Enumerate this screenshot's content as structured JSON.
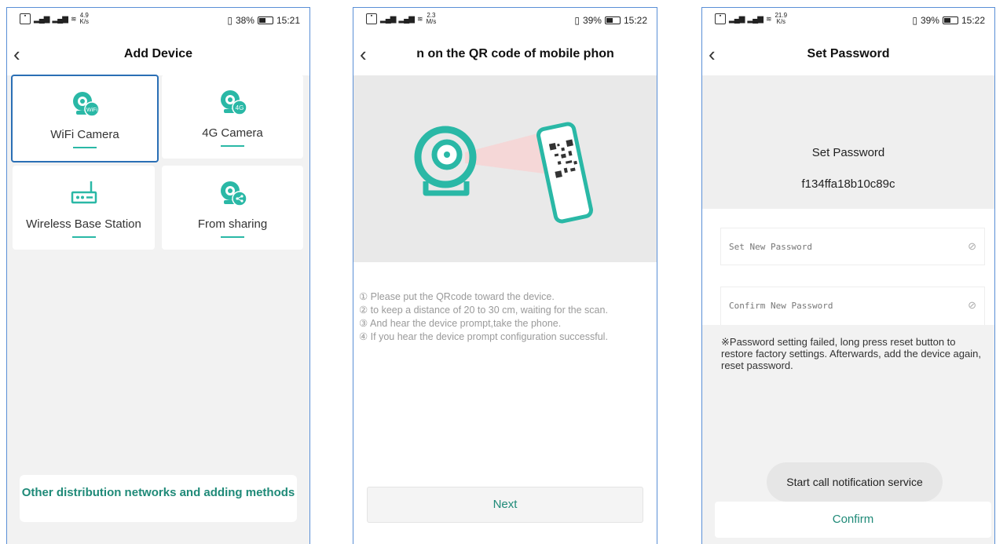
{
  "colors": {
    "accent": "#2ab8a6",
    "accent_text": "#1f8a78",
    "selected_border": "#2a6fb5"
  },
  "status": [
    {
      "speed": "4.9",
      "unit": "K/s",
      "battery": "38%",
      "time": "15:21"
    },
    {
      "speed": "2.3",
      "unit": "M/s",
      "battery": "39%",
      "time": "15:22"
    },
    {
      "speed": "21.9",
      "unit": "K/s",
      "battery": "39%",
      "time": "15:22"
    }
  ],
  "add_device": {
    "title": "Add Device",
    "tiles": [
      {
        "label": "WiFi Camera",
        "icon": "wifi-camera-icon",
        "badge": "WiFi"
      },
      {
        "label": "4G Camera",
        "icon": "4g-camera-icon",
        "badge": "4G"
      },
      {
        "label": "Wireless Base Station",
        "icon": "router-icon"
      },
      {
        "label": "From sharing",
        "icon": "share-camera-icon"
      }
    ],
    "other_button": "Other distribution networks and adding methods"
  },
  "scan": {
    "title": "n on the QR code of mobile phon",
    "steps": [
      "① Please put the QRcode toward the device.",
      "② to keep a distance of 20 to 30 cm, waiting for the scan.",
      "③ And hear the device prompt,take the phone.",
      "④ If you hear the device prompt configuration successful."
    ],
    "next_button": "Next"
  },
  "password": {
    "title": "Set Password",
    "heading": "Set Password",
    "device_id": "f134ffa18b10c89c",
    "new_placeholder": "Set New Password",
    "confirm_placeholder": "Confirm New Password",
    "note": "※Password setting failed, long press reset button to restore factory settings. Afterwards, add the device again, reset password.",
    "toast": "Start call notification service",
    "confirm_button": "Confirm"
  }
}
